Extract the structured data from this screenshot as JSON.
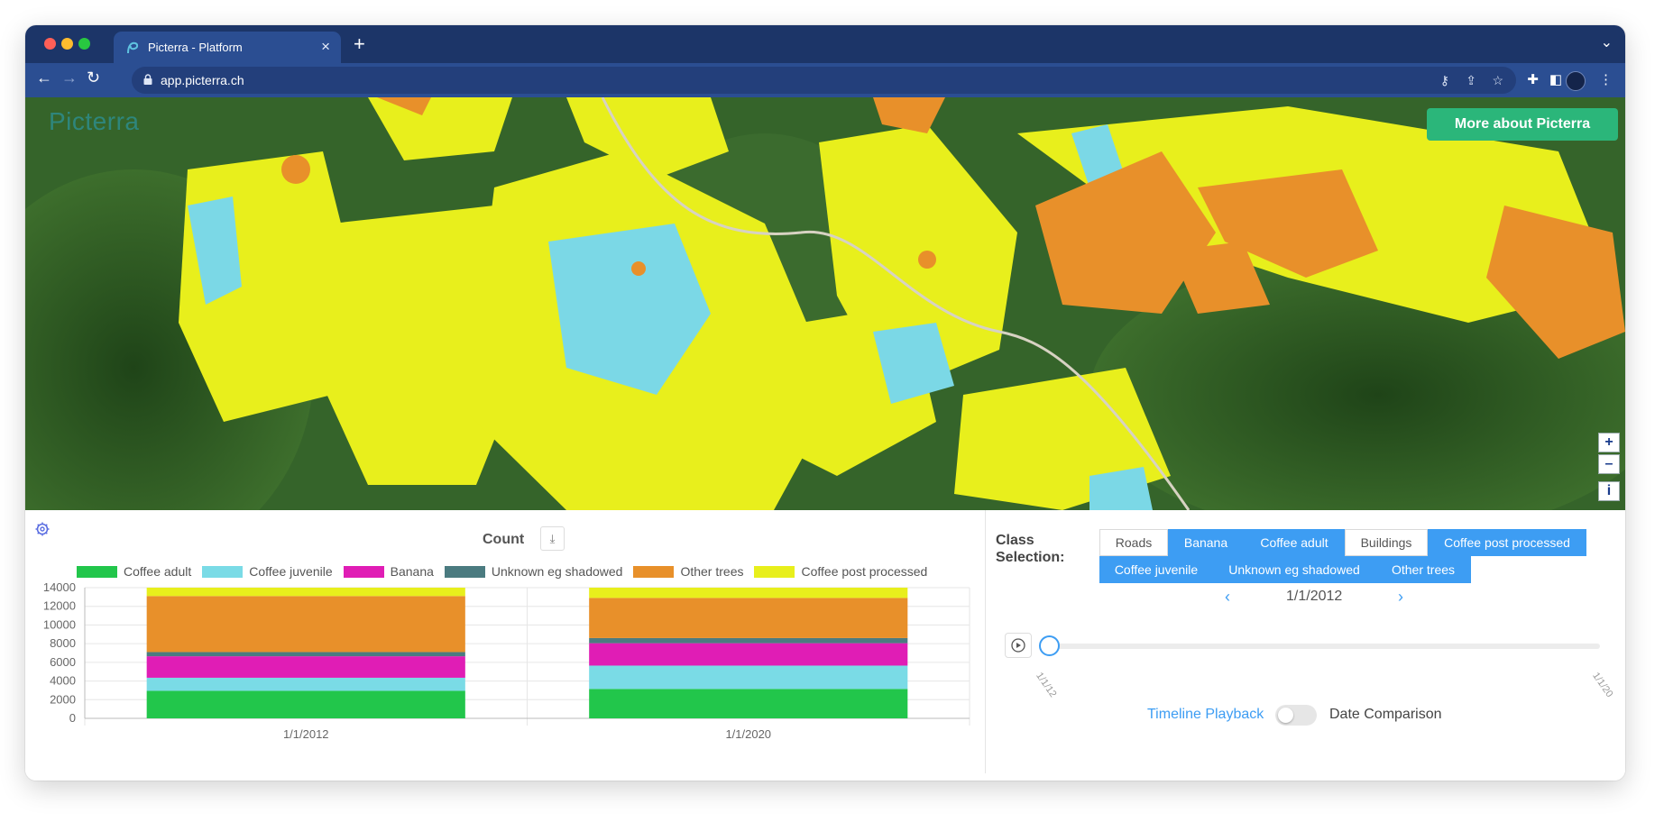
{
  "browser": {
    "tab_title": "Picterra - Platform",
    "tab_close": "×",
    "new_tab": "+",
    "url": "app.picterra.ch"
  },
  "map": {
    "brand": "Picterra",
    "more_button": "More about Picterra",
    "zoom_in": "+",
    "zoom_out": "–",
    "info": "i",
    "colors": {
      "coffee_post_processed": "#e8ef1c",
      "coffee_juvenile": "#7bd8e6",
      "other_trees": "#e8902a",
      "vegetation": "#2f5c23"
    }
  },
  "chart_data": {
    "type": "bar",
    "stacked": true,
    "title": "Count",
    "categories": [
      "1/1/2012",
      "1/1/2020"
    ],
    "yticks": [
      0,
      2000,
      4000,
      6000,
      8000,
      10000,
      12000,
      14000
    ],
    "ylim": [
      0,
      14000
    ],
    "grid": true,
    "legend_position": "top",
    "series": [
      {
        "name": "Coffee adult",
        "color": "#22c64b",
        "values": [
          2950,
          3150
        ]
      },
      {
        "name": "Coffee juvenile",
        "color": "#7adbe6",
        "values": [
          1400,
          2500
        ]
      },
      {
        "name": "Banana",
        "color": "#e01db5",
        "values": [
          2300,
          2400
        ]
      },
      {
        "name": "Unknown eg shadowed",
        "color": "#4b7b80",
        "values": [
          450,
          550
        ]
      },
      {
        "name": "Other trees",
        "color": "#e8902a",
        "values": [
          6000,
          4300
        ]
      },
      {
        "name": "Coffee post processed",
        "color": "#e8ef1c",
        "values": [
          900,
          1100
        ]
      }
    ]
  },
  "controls": {
    "class_selection_label_1": "Class",
    "class_selection_label_2": "Selection:",
    "chips": [
      {
        "label": "Roads",
        "active": false
      },
      {
        "label": "Banana",
        "active": true
      },
      {
        "label": "Coffee adult",
        "active": true
      },
      {
        "label": "Buildings",
        "active": false
      },
      {
        "label": "Coffee post processed",
        "active": true
      },
      {
        "label": "Coffee juvenile",
        "active": true
      },
      {
        "label": "Unknown eg shadowed",
        "active": true
      },
      {
        "label": "Other trees",
        "active": true
      }
    ],
    "prev": "‹",
    "next": "›",
    "current_date": "1/1/2012",
    "timeline_start": "1/1/12",
    "timeline_end": "1/1/20",
    "timeline_position": 0,
    "mode_a": "Timeline Playback",
    "mode_b": "Date Comparison",
    "toggle_on": false,
    "accent": "#3d9df3"
  }
}
